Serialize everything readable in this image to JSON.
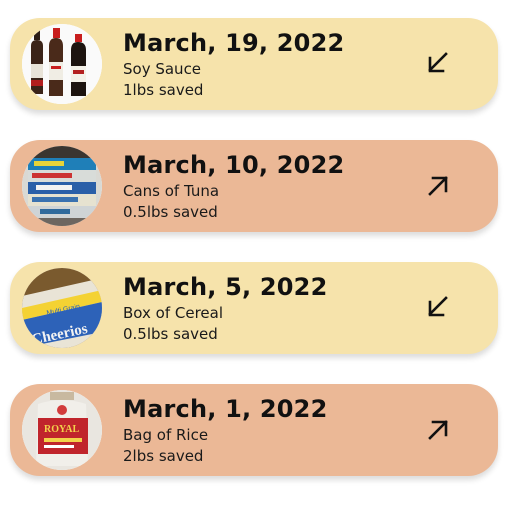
{
  "entries": [
    {
      "date": "March, 19, 2022",
      "item": "Soy Sauce",
      "saved": "1lbs saved",
      "color": "#f6e3ab",
      "trend_icon": "arrow-down-left-icon",
      "image": "soy-sauce-bottles"
    },
    {
      "date": "March, 10, 2022",
      "item": "Cans of Tuna",
      "saved": "0.5lbs saved",
      "color": "#ebb896",
      "trend_icon": "arrow-up-right-icon",
      "image": "tuna-cans"
    },
    {
      "date": "March, 5, 2022",
      "item": "Box of Cereal",
      "saved": "0.5lbs saved",
      "color": "#f6e3ab",
      "trend_icon": "arrow-down-left-icon",
      "image": "cereal-box"
    },
    {
      "date": "March, 1, 2022",
      "item": "Bag of Rice",
      "saved": "2lbs saved",
      "color": "#ebb896",
      "trend_icon": "arrow-up-right-icon",
      "image": "rice-bag"
    }
  ]
}
